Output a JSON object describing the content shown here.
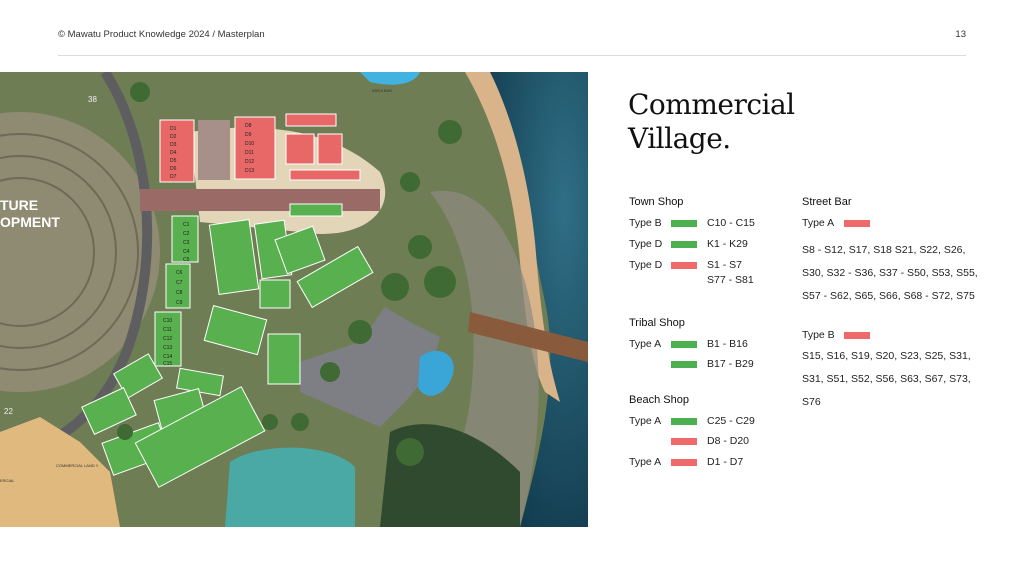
{
  "header": {
    "left": "© Mawatu Product Knowledge 2024  / Masterplan",
    "page": "13"
  },
  "title": {
    "line1": "Commercial",
    "line2": "Village."
  },
  "map": {
    "labels": {
      "future": "TURE",
      "development": "OPMENT",
      "area_bar": "AREA BAR",
      "commercial_land": "COMMERCIAL LAND Y",
      "mercial": "ERCIAL",
      "num22": "22",
      "num38": "38"
    },
    "red_units_a": [
      "D1",
      "D2",
      "D3",
      "D4",
      "D5",
      "D6",
      "D7"
    ],
    "red_units_b": [
      "D8",
      "D9",
      "D10",
      "D11",
      "D12",
      "D13"
    ],
    "green_c": [
      "C1",
      "C2",
      "C3",
      "C4",
      "C5"
    ],
    "green_c2": [
      "C6",
      "C7",
      "C8",
      "C9"
    ],
    "green_c3": [
      "C10",
      "C11",
      "C12",
      "C13",
      "C14",
      "C15"
    ]
  },
  "colors": {
    "green": "#4caf50",
    "red": "#ef6b6b"
  },
  "legend": {
    "town_shop": {
      "title": "Town Shop",
      "rows": [
        {
          "label": "Type B",
          "color": "green",
          "range": "C10 - C15"
        },
        {
          "label": "Type D",
          "color": "green",
          "range": "K1 - K29"
        },
        {
          "label": "Type D",
          "color": "red",
          "range": "S1 - S7"
        }
      ],
      "extra": "S77 - S81"
    },
    "tribal_shop": {
      "title": "Tribal Shop",
      "rows": [
        {
          "label": "Type A",
          "color": "green",
          "range": "B1 - B16"
        },
        {
          "label": "",
          "color": "green",
          "range": "B17 - B29"
        }
      ]
    },
    "beach_shop": {
      "title": "Beach Shop",
      "rows": [
        {
          "label": "Type A",
          "color": "green",
          "range": "C25 - C29"
        },
        {
          "label": "",
          "color": "red",
          "range": "D8 - D20"
        },
        {
          "label": "Type A",
          "color": "red",
          "range": "D1 - D7"
        }
      ]
    },
    "street_bar": {
      "title": "Street Bar",
      "type_a": {
        "label": "Type A",
        "color": "red",
        "units": "S8 - S12, S17, S18 S21, S22, S26, S30, S32 - S36, S37 - S50, S53, S55, S57 - S62, S65, S66, S68 - S72, S75"
      },
      "type_b": {
        "label": "Type B",
        "color": "red",
        "units": "S15, S16, S19, S20, S23, S25, S31, S31, S51, S52, S56, S63, S67, S73, S76"
      }
    }
  }
}
